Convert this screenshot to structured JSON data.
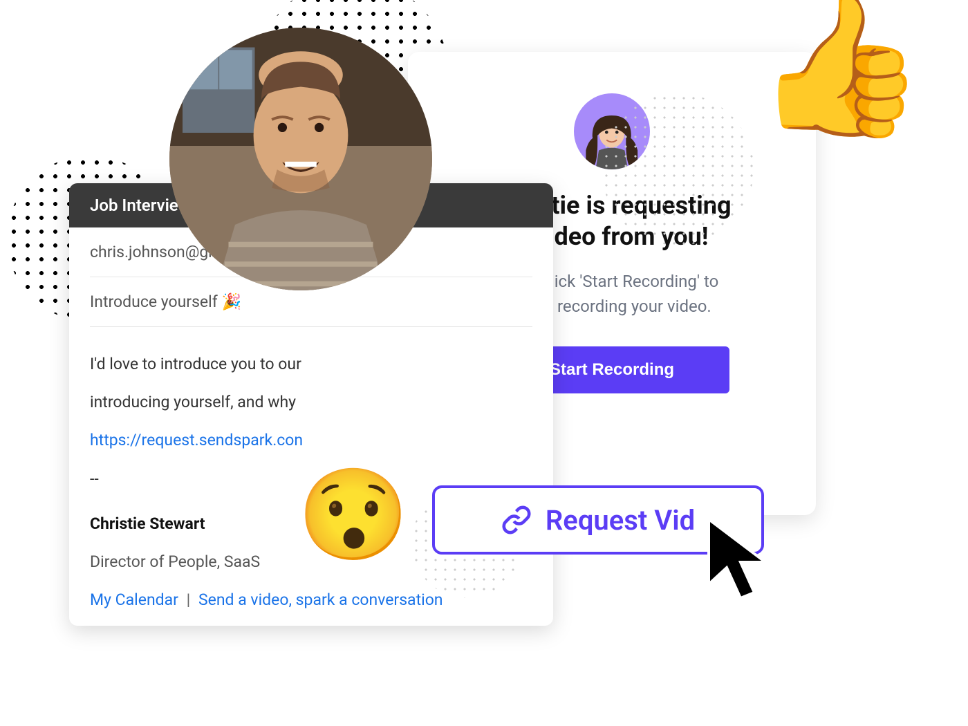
{
  "request_modal": {
    "title_line1": "Christie is requesting",
    "title_line2": "a video from you!",
    "subtitle_line1": "Just click 'Start Recording' to",
    "subtitle_line2": "begin recording your video.",
    "button_label": "Start Recording"
  },
  "email": {
    "header": "Job Intervie",
    "to": "chris.johnson@gma",
    "subject_text": "Introduce yourself ",
    "subject_emoji": "🎉",
    "body_line1": "I'd love to introduce you to our",
    "body_line2": "introducing yourself, and why",
    "link_url": "https://request.sendspark.con",
    "sig_divider": "--",
    "sig_name": "Christie Stewart",
    "sig_title": "Director of People, SaaS",
    "sig_link1": "My Calendar",
    "sig_separator": "|",
    "sig_link2": "Send a video, spark a conversation"
  },
  "request_button": {
    "label": "Request Vid"
  },
  "decorations": {
    "thumbsup": "👍",
    "surprised": "😯"
  },
  "colors": {
    "primary": "#5b3df5",
    "link": "#1a73e8",
    "avatar_bg": "#a78bfa"
  }
}
